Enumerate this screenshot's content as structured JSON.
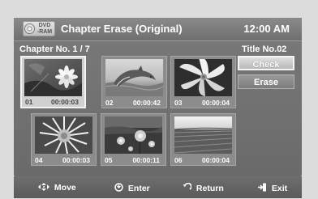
{
  "header": {
    "disc_type_line1": "DVD",
    "disc_type_line2": "-RAM",
    "title": "Chapter Erase (Original)",
    "clock": "12:00 AM"
  },
  "info": {
    "chapter_no": "Chapter No. 1 / 7",
    "title_no": "Title No.02"
  },
  "chapters": [
    {
      "num": "01",
      "time": "00:00:03",
      "selected": true,
      "scene": "flower-on-rocks"
    },
    {
      "num": "02",
      "time": "00:00:42",
      "selected": false,
      "scene": "dolphin-leaping"
    },
    {
      "num": "03",
      "time": "00:00:04",
      "selected": false,
      "scene": "white-flower"
    },
    {
      "num": "04",
      "time": "00:00:03",
      "selected": false,
      "scene": "dandelion-flower"
    },
    {
      "num": "05",
      "time": "00:00:11",
      "selected": false,
      "scene": "flowers-field"
    },
    {
      "num": "06",
      "time": "00:00:04",
      "selected": false,
      "scene": "crop-field"
    }
  ],
  "buttons": {
    "check": "Check",
    "erase": "Erase"
  },
  "footer": {
    "move": "Move",
    "enter": "Enter",
    "return": "Return",
    "exit": "Exit"
  },
  "icons": {
    "disc": "disc-icon",
    "move": "arrows-icon",
    "enter": "enter-icon",
    "return": "return-icon",
    "exit": "exit-icon"
  }
}
